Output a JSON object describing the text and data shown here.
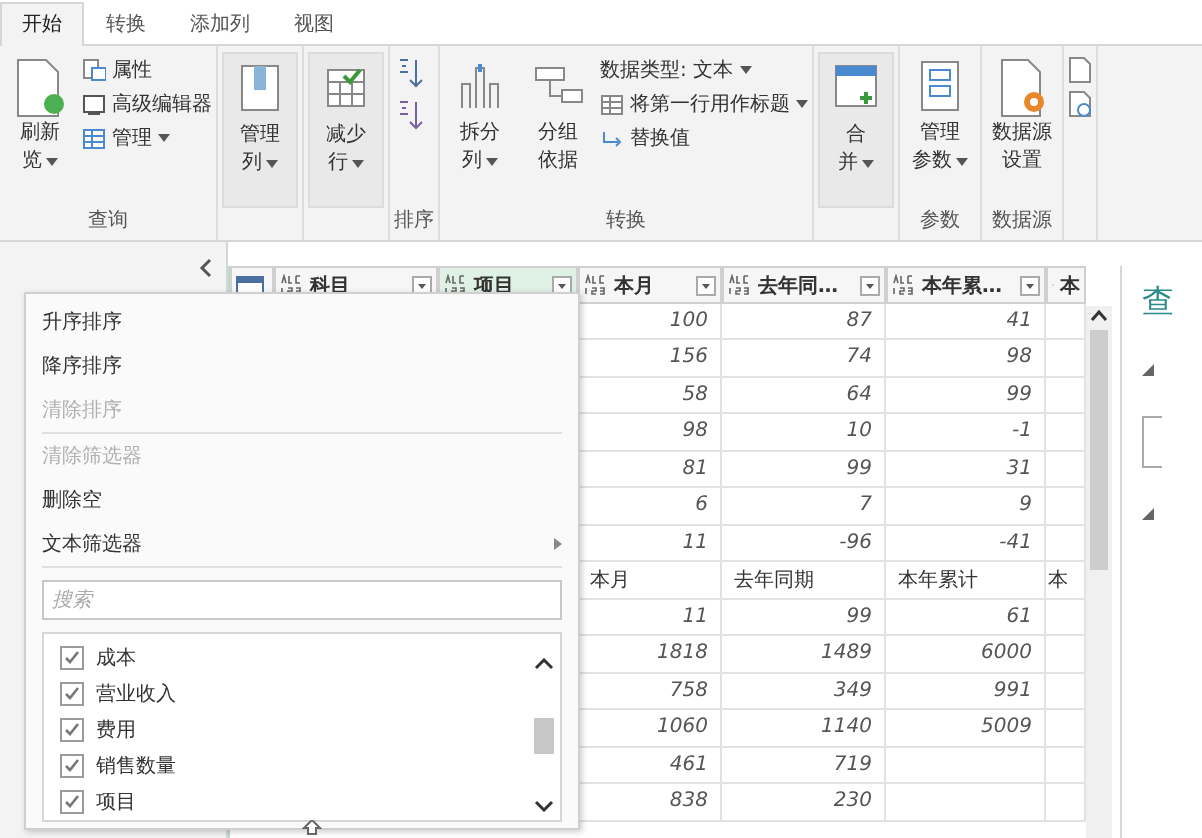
{
  "ribbon_tabs": [
    {
      "label": "开始",
      "selected": true
    },
    {
      "label": "转换",
      "selected": false
    },
    {
      "label": "添加列",
      "selected": false
    },
    {
      "label": "视图",
      "selected": false
    }
  ],
  "ribbon_groups": [
    {
      "label": "查询",
      "controls": [
        {
          "kind": "large",
          "lines": [
            "刷新",
            "览"
          ],
          "dropdown": true
        },
        {
          "kind": "stack",
          "items": [
            {
              "label": "属性",
              "dropdown": false
            },
            {
              "label": "高级编辑器",
              "dropdown": false
            },
            {
              "label": "管理",
              "dropdown": true
            }
          ]
        }
      ]
    },
    {
      "controls": [
        {
          "kind": "large",
          "lines": [
            "管理",
            "列"
          ],
          "dropdown": true,
          "boxed": true
        }
      ]
    },
    {
      "controls": [
        {
          "kind": "large",
          "lines": [
            "减少",
            "行"
          ],
          "dropdown": true,
          "boxed": true
        }
      ]
    },
    {
      "label": "排序",
      "controls": [
        {
          "kind": "sort"
        }
      ]
    },
    {
      "label": "转换",
      "controls": [
        {
          "kind": "large",
          "lines": [
            "拆分",
            "列"
          ],
          "dropdown": true
        },
        {
          "kind": "large",
          "lines": [
            "分组",
            "依据"
          ],
          "dropdown": false
        },
        {
          "kind": "stack",
          "items": [
            {
              "label": "数据类型: 文本",
              "dropdown": true
            },
            {
              "label": "将第一行用作标题",
              "dropdown": true
            },
            {
              "label": "替换值",
              "dropdown": false
            }
          ]
        }
      ]
    },
    {
      "controls": [
        {
          "kind": "large",
          "lines": [
            "合",
            "并"
          ],
          "dropdown": true,
          "boxed": true
        }
      ]
    },
    {
      "label": "参数",
      "controls": [
        {
          "kind": "large",
          "lines": [
            "管理",
            "参数"
          ],
          "dropdown": true
        }
      ]
    },
    {
      "label": "数据源",
      "controls": [
        {
          "kind": "large",
          "lines": [
            "数据源",
            "设置"
          ],
          "dropdown": false
        }
      ]
    }
  ],
  "grid": {
    "columns": [
      {
        "label": "科目",
        "highlighted": false
      },
      {
        "label": "项目",
        "highlighted": true
      },
      {
        "label": "本月",
        "highlighted": false
      },
      {
        "label": "去年同…",
        "highlighted": false
      },
      {
        "label": "本年累…",
        "highlighted": false
      },
      {
        "label": "本",
        "highlighted": false
      }
    ],
    "rows": [
      {
        "kind": "number",
        "cells": [
          null,
          null,
          "100",
          "87",
          "41",
          null
        ]
      },
      {
        "kind": "number",
        "cells": [
          null,
          null,
          "156",
          "74",
          "98",
          null
        ]
      },
      {
        "kind": "number",
        "cells": [
          null,
          null,
          "58",
          "64",
          "99",
          null
        ]
      },
      {
        "kind": "number",
        "cells": [
          null,
          null,
          "98",
          "10",
          "-1",
          null
        ]
      },
      {
        "kind": "number",
        "cells": [
          null,
          null,
          "81",
          "99",
          "31",
          null
        ]
      },
      {
        "kind": "number",
        "cells": [
          null,
          null,
          "6",
          "7",
          "9",
          null
        ]
      },
      {
        "kind": "number",
        "cells": [
          null,
          null,
          "11",
          "-96",
          "-41",
          null
        ]
      },
      {
        "kind": "text",
        "cells": [
          null,
          null,
          "本月",
          "去年同期",
          "本年累计",
          "本"
        ]
      },
      {
        "kind": "number",
        "cells": [
          null,
          null,
          "11",
          "99",
          "61",
          null
        ]
      },
      {
        "kind": "number",
        "cells": [
          null,
          null,
          "1818",
          "1489",
          "6000",
          null
        ]
      },
      {
        "kind": "number",
        "cells": [
          null,
          null,
          "758",
          "349",
          "991",
          null
        ]
      },
      {
        "kind": "number",
        "cells": [
          null,
          null,
          "1060",
          "1140",
          "5009",
          null
        ]
      },
      {
        "kind": "number",
        "cells": [
          null,
          null,
          "461",
          "719",
          null,
          null
        ]
      },
      {
        "kind": "number",
        "cells": [
          null,
          null,
          "838",
          "230",
          null,
          null
        ]
      }
    ]
  },
  "filter_menu": {
    "items": [
      {
        "kind": "action",
        "label": "升序排序",
        "disabled": false
      },
      {
        "kind": "action",
        "label": "降序排序",
        "disabled": false
      },
      {
        "kind": "action",
        "label": "清除排序",
        "disabled": true
      },
      {
        "kind": "separator"
      },
      {
        "kind": "action",
        "label": "清除筛选器",
        "disabled": true
      },
      {
        "kind": "action",
        "label": "删除空",
        "disabled": false
      },
      {
        "kind": "submenu",
        "label": "文本筛选器",
        "disabled": false
      },
      {
        "kind": "separator"
      }
    ],
    "search": {
      "placeholder": "搜索"
    },
    "values": [
      {
        "label": "成本",
        "checked": true
      },
      {
        "label": "营业收入",
        "checked": true
      },
      {
        "label": "费用",
        "checked": true
      },
      {
        "label": "销售数量",
        "checked": true
      },
      {
        "label": "项目",
        "checked": true
      }
    ]
  },
  "settings_pane": {
    "title": "查"
  }
}
